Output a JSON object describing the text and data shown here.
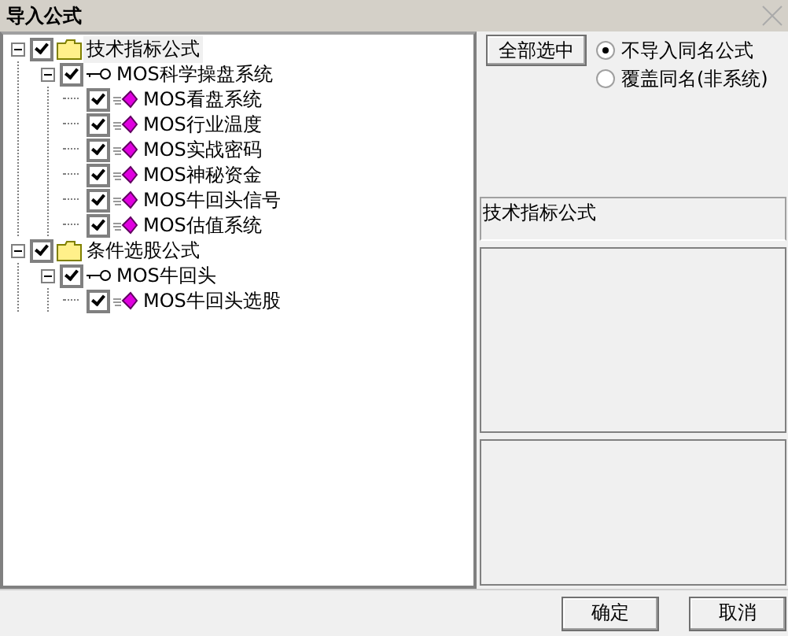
{
  "window": {
    "title": "导入公式"
  },
  "tree": [
    {
      "label": "技术指标公式",
      "kind": "folder",
      "checked": true,
      "expanded": true,
      "selected": true,
      "children": [
        {
          "label": "MOS科学操盘系统",
          "kind": "key",
          "checked": true,
          "expanded": true,
          "selected": false,
          "children": [
            {
              "label": "MOS看盘系统",
              "kind": "formula",
              "checked": true,
              "selected": false
            },
            {
              "label": "MOS行业温度",
              "kind": "formula",
              "checked": true,
              "selected": false
            },
            {
              "label": "MOS实战密码",
              "kind": "formula",
              "checked": true,
              "selected": false
            },
            {
              "label": "MOS神秘资金",
              "kind": "formula",
              "checked": true,
              "selected": false
            },
            {
              "label": "MOS牛回头信号",
              "kind": "formula",
              "checked": true,
              "selected": false
            },
            {
              "label": "MOS估值系统",
              "kind": "formula",
              "checked": true,
              "selected": false
            }
          ]
        }
      ]
    },
    {
      "label": "条件选股公式",
      "kind": "folder",
      "checked": true,
      "expanded": true,
      "selected": false,
      "children": [
        {
          "label": "MOS牛回头",
          "kind": "key",
          "checked": true,
          "expanded": true,
          "selected": false,
          "children": [
            {
              "label": "MOS牛回头选股",
              "kind": "formula",
              "checked": true,
              "selected": false
            }
          ]
        }
      ]
    }
  ],
  "select_all_button": "全部选中",
  "options": [
    {
      "label": "不导入同名公式",
      "selected": true
    },
    {
      "label": "覆盖同名(非系统)",
      "selected": false
    }
  ],
  "category_field": {
    "value": "技术指标公式"
  },
  "buttons": [
    "确定",
    "取消"
  ]
}
